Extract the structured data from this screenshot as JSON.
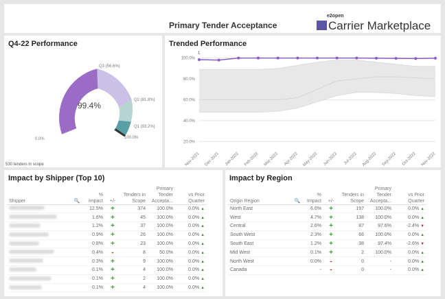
{
  "header": {
    "title": "Primary Tender Acceptance",
    "logo_super": "e2open",
    "logo_text": "Carrier Marketplace"
  },
  "performance": {
    "title": "Q4-22 Performance",
    "center_value": "99.4%",
    "labels": {
      "q3": "Q3 (56.6%)",
      "q2": "Q2 (81.8%)",
      "q1": "Q1 (93.2%)",
      "min": "0.0%",
      "max": "100.0%"
    },
    "footnote": "530 tenders in scope",
    "colors": {
      "q4": "#9a6cc6",
      "q3": "#cbc0e6",
      "q2": "#b7d6d2",
      "q1": "#5a9fa5",
      "needle": "#333333"
    }
  },
  "trend": {
    "title": "Trended Performance",
    "marker_label": "1"
  },
  "chart_data": {
    "type": "line",
    "x": [
      "Nov-2021",
      "Dec-2021",
      "Jan-2022",
      "Feb-2022",
      "Mar-2022",
      "Apr-2022",
      "May-2022",
      "Jun-2022",
      "Jul-2022",
      "Aug-2022",
      "Sep-2022",
      "Oct-2022",
      "Nov-2022"
    ],
    "series": [
      {
        "values": [
          98.4,
          98.0,
          100,
          100,
          100,
          100,
          100,
          100,
          100,
          99.8,
          99.6,
          99.5,
          99.8
        ],
        "color": "#8a5cc0"
      }
    ],
    "band": {
      "upper": [
        89,
        89,
        89,
        89,
        90,
        93,
        96,
        98,
        98,
        96,
        94,
        92,
        92
      ],
      "lower": [
        48,
        48,
        48,
        48,
        49,
        52,
        58,
        64,
        67,
        67,
        66,
        64,
        63
      ],
      "middle": [
        60,
        60,
        60,
        60,
        60,
        62,
        70,
        78,
        80,
        82,
        82,
        81,
        80
      ],
      "color": "#e8e8e8"
    },
    "ytick_labels": [
      "100.0%",
      "80.0%",
      "60.0%",
      "40.0%",
      "20.0%"
    ],
    "ytick_values": [
      100,
      80,
      60,
      40,
      20
    ],
    "ylim": [
      15,
      103
    ],
    "grid": true
  },
  "shipper": {
    "title": "Impact by Shipper (Top 10)",
    "columns": [
      "Shipper",
      "%\nImpact",
      "+/-",
      "Tenders in\nScope",
      "Primary\nTender\nAccepta...",
      "vs Prior\nQuarter"
    ],
    "rows": [
      {
        "impact": "12.5%",
        "sign": "+",
        "tenders": "374",
        "accept": "100.0%",
        "vs": "0.0%",
        "trend": "up"
      },
      {
        "impact": "1.6%",
        "sign": "+",
        "tenders": "45",
        "accept": "100.0%",
        "vs": "0.0%",
        "trend": "up"
      },
      {
        "impact": "1.2%",
        "sign": "+",
        "tenders": "37",
        "accept": "100.0%",
        "vs": "0.0%",
        "trend": "up"
      },
      {
        "impact": "0.9%",
        "sign": "+",
        "tenders": "26",
        "accept": "100.0%",
        "vs": "0.0%",
        "trend": "up"
      },
      {
        "impact": "0.8%",
        "sign": "+",
        "tenders": "23",
        "accept": "100.0%",
        "vs": "0.0%",
        "trend": "up"
      },
      {
        "impact": "0.4%",
        "sign": "-",
        "tenders": "8",
        "accept": "50.0%",
        "vs": "0.0%",
        "trend": "up"
      },
      {
        "impact": "0.3%",
        "sign": "+",
        "tenders": "9",
        "accept": "100.0%",
        "vs": "0.0%",
        "trend": "up"
      },
      {
        "impact": "0.1%",
        "sign": "+",
        "tenders": "4",
        "accept": "100.0%",
        "vs": "0.0%",
        "trend": "up"
      },
      {
        "impact": "0.1%",
        "sign": "+",
        "tenders": "2",
        "accept": "100.0%",
        "vs": "0.0%",
        "trend": "up"
      },
      {
        "impact": "0.1%",
        "sign": "+",
        "tenders": "4",
        "accept": "100.0%",
        "vs": "0.0%",
        "trend": "up"
      }
    ]
  },
  "region": {
    "title": "Impact by Region",
    "columns": [
      "Origin Region",
      "%\nImpact",
      "+/-",
      "Tenders in\nScope",
      "Primary\nTender\nAccepta...",
      "vs Prior\nQuarter"
    ],
    "rows": [
      {
        "name": "North East",
        "impact": "6.6%",
        "sign": "+",
        "tenders": "197",
        "accept": "100.0%",
        "vs": "0.0%",
        "trend": "up"
      },
      {
        "name": "West",
        "impact": "4.7%",
        "sign": "+",
        "tenders": "138",
        "accept": "100.0%",
        "vs": "0.0%",
        "trend": "up"
      },
      {
        "name": "Central",
        "impact": "2.6%",
        "sign": "+",
        "tenders": "87",
        "accept": "97.6%",
        "vs": "-2.4%",
        "trend": "down"
      },
      {
        "name": "South West",
        "impact": "2.3%",
        "sign": "+",
        "tenders": "66",
        "accept": "100.0%",
        "vs": "0.0%",
        "trend": "up"
      },
      {
        "name": "South East",
        "impact": "1.2%",
        "sign": "+",
        "tenders": "38",
        "accept": "97.4%",
        "vs": "-2.6%",
        "trend": "down"
      },
      {
        "name": "Mid West",
        "impact": "0.1%",
        "sign": "+",
        "tenders": "2",
        "accept": "100.0%",
        "vs": "0.0%",
        "trend": "up"
      },
      {
        "name": "North West",
        "impact": "0.0%",
        "sign": "-",
        "tenders": "0",
        "accept": "-",
        "vs": "0.0%",
        "trend": "up"
      },
      {
        "name": "Canada",
        "impact": "-",
        "sign": "-",
        "tenders": "0",
        "accept": "-",
        "vs": "0.0%",
        "trend": "up"
      }
    ]
  }
}
